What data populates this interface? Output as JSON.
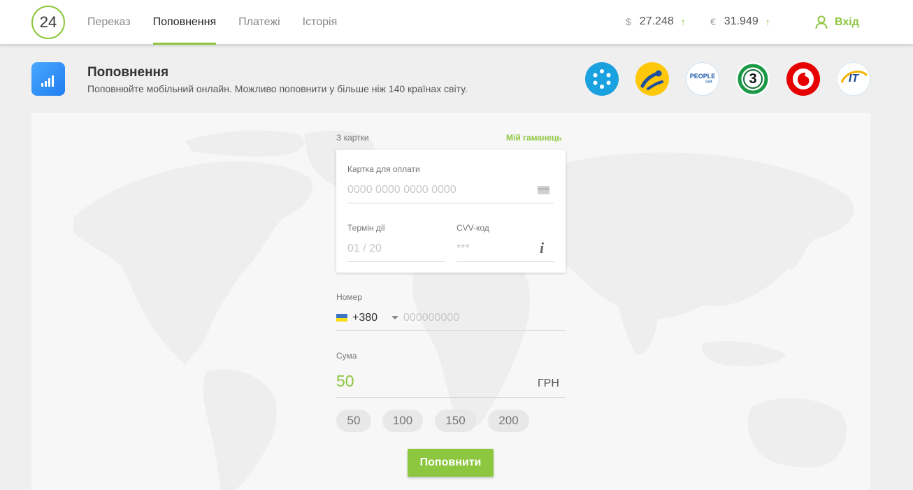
{
  "header": {
    "logo_text": "24",
    "nav": [
      {
        "label": "Переказ"
      },
      {
        "label": "Поповнення"
      },
      {
        "label": "Платежі"
      },
      {
        "label": "Історія"
      }
    ],
    "rates": [
      {
        "currency": "$",
        "value": "27.248",
        "arrow": "↑"
      },
      {
        "currency": "€",
        "value": "31.949",
        "arrow": "↑"
      }
    ],
    "login_label": "Вхід"
  },
  "section": {
    "title": "Поповнення",
    "subtitle": "Поповнюйте мобільний онлайн. Можливо поповнити у більше ніж 140 країнах світу."
  },
  "operators": [
    {
      "name": "kyivstar",
      "icon": "kyivstar-logo",
      "color": "#1aa1df"
    },
    {
      "name": "lifecell",
      "icon": "lifecell-logo",
      "color": "#ffc70a"
    },
    {
      "name": "peoplenet",
      "icon": "peoplenet-logo",
      "text": "PEOPLE",
      "subtext": "net"
    },
    {
      "name": "3mob",
      "icon": "trimob-logo",
      "text": "3"
    },
    {
      "name": "vodafone",
      "icon": "vodafone-logo",
      "color": "#e60000"
    },
    {
      "name": "intertelecom",
      "icon": "intertelecom-logo",
      "text": "IT"
    }
  ],
  "form": {
    "from_card_label": "З картки",
    "wallet_link": "Мій гаманець",
    "card_number_label": "Картка для оплати",
    "card_number_placeholder": "0000 0000 0000 0000",
    "expiry_label": "Термін дії",
    "expiry_placeholder": "01 / 20",
    "cvv_label": "CVV-код",
    "cvv_placeholder": "***",
    "cvv_info": "i",
    "phone_label": "Номер",
    "phone_code": "+380",
    "phone_placeholder": "000000000",
    "amount_label": "Сума",
    "amount_value": "50",
    "currency": "ГРН",
    "presets": [
      "50",
      "100",
      "150",
      "200"
    ],
    "submit_label": "Поповнити"
  },
  "colors": {
    "accent": "#8dc63f",
    "panel": "#f7f7f7",
    "background": "#efefef"
  }
}
